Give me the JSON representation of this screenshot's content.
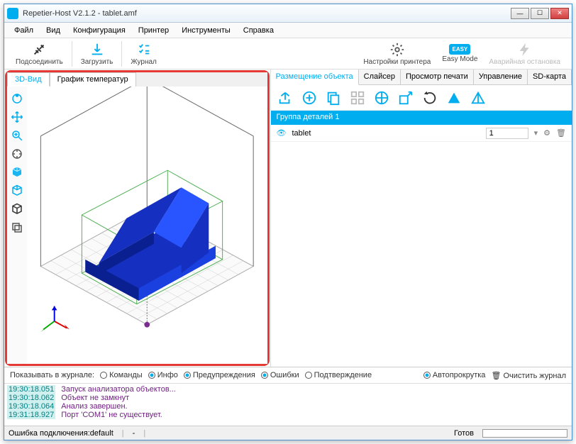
{
  "title": "Repetier-Host V2.1.2 - tablet.amf",
  "menu": [
    "Файл",
    "Вид",
    "Конфигурация",
    "Принтер",
    "Инструменты",
    "Справка"
  ],
  "toolbar": {
    "connect": "Подсоединить",
    "load": "Загрузить",
    "journal": "Журнал",
    "printer_settings": "Настройки принтера",
    "easy": "EASY",
    "easy_mode": "Easy Mode",
    "estop": "Аварийная остановка"
  },
  "view_tabs": {
    "view3d": "3D-Вид",
    "temp": "График температур"
  },
  "right_tabs": [
    "Размещение объекта",
    "Слайсер",
    "Просмотр печати",
    "Управление",
    "SD-карта"
  ],
  "group": {
    "header": "Группа деталей 1",
    "item": {
      "name": "tablet",
      "count": "1"
    }
  },
  "log": {
    "label": "Показывать в журнале:",
    "cmds": "Команды",
    "info": "Инфо",
    "warn": "Предупреждения",
    "err": "Ошибки",
    "ack": "Подтверждение",
    "auto": "Автопрокрутка",
    "clear": "Очистить журнал",
    "lines": [
      {
        "ts": "19:30:18.051",
        "msg": "Запуск анализатора объектов..."
      },
      {
        "ts": "19:30:18.062",
        "msg": "Объект не замкнут"
      },
      {
        "ts": "19:30:18.064",
        "msg": "Анализ завершен."
      },
      {
        "ts": "19:31:18.927",
        "msg": "Порт 'COM1' не существует."
      }
    ]
  },
  "status": {
    "conn": "Ошибка подключения:default",
    "ready": "Готов"
  }
}
